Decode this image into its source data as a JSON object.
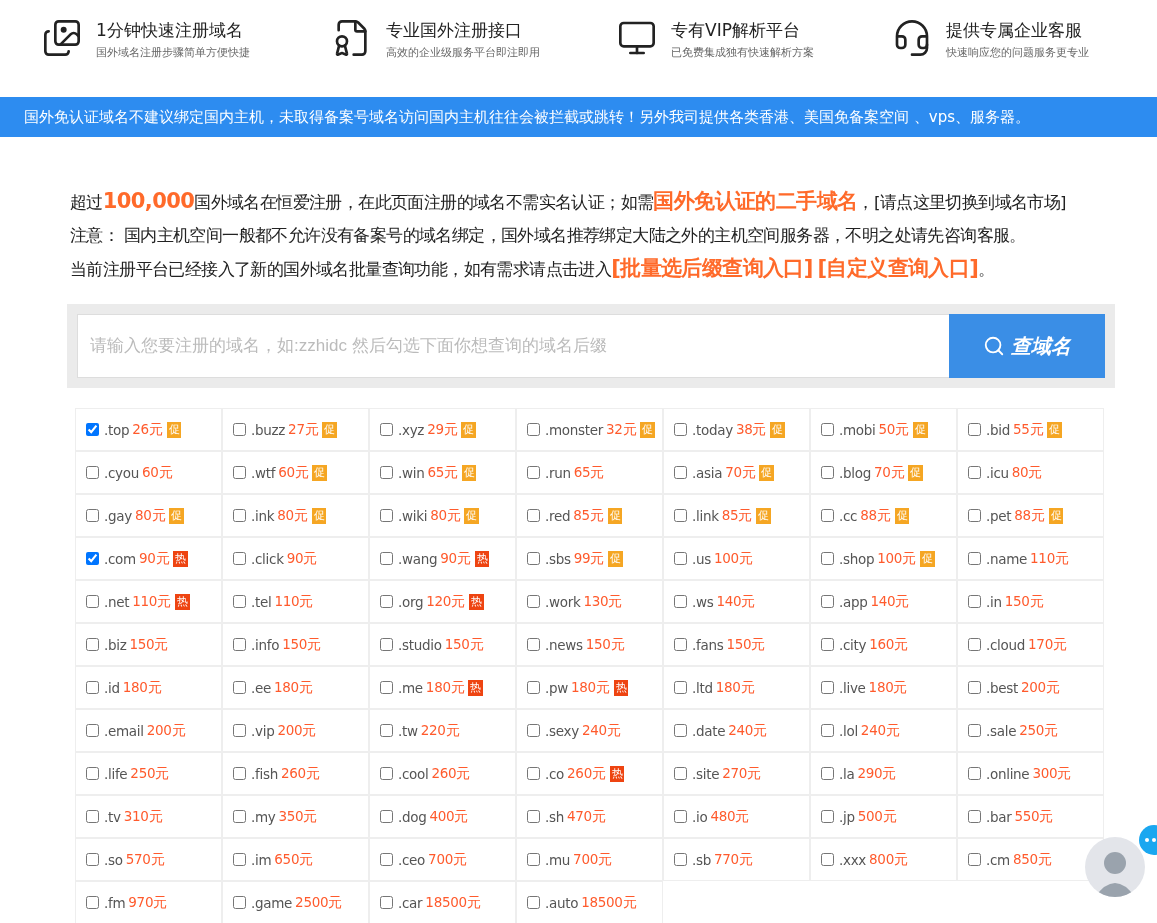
{
  "features": [
    {
      "title": "1分钟快速注册域名",
      "subtitle": "国外域名注册步骤简单方便快捷"
    },
    {
      "title": "专业国外注册接口",
      "subtitle": "高效的企业级服务平台即注即用"
    },
    {
      "title": "专有VIP解析平台",
      "subtitle": "已免费集成独有快速解析方案"
    },
    {
      "title": "提供专属企业客服",
      "subtitle": "快速响应您的问题服务更专业"
    }
  ],
  "notice": "国外免认证域名不建议绑定国内主机，未取得备案号域名访问国内主机往往会被拦截或跳转！另外我司提供各类香港、美国免备案空间 、vps、服务器。",
  "intro": [
    "超过**100,000**国外域名在恒爱注册，在此页面注册的域名不需实名认证；如需**国外免认证的二手域名**，[请点这里切换到域名市场]",
    "注意： 国内主机空间一般都不允许没有备案号的域名绑定，国外域名推荐绑定大陆之外的主机空间服务器，不明之处请先咨询客服。",
    "当前注册平台已经接入了新的国外域名批量查询功能，如有需求请点击进入**[批量选后缀查询入口]**  **[自定义查询入口]**。"
  ],
  "search": {
    "placeholder": "请输入您要注册的域名，如:zzhidc 然后勾选下面你想查询的域名后缀",
    "button": "查域名"
  },
  "domains": [
    {
      "name": ".top",
      "price": "26元",
      "checked": true,
      "tag": {
        "kind": "promo",
        "text": "促"
      }
    },
    {
      "name": ".buzz",
      "price": "27元",
      "checked": false,
      "tag": {
        "kind": "promo",
        "text": "促"
      }
    },
    {
      "name": ".xyz",
      "price": "29元",
      "checked": false,
      "tag": {
        "kind": "promo",
        "text": "促"
      }
    },
    {
      "name": ".monster",
      "price": "32元",
      "checked": false,
      "tag": {
        "kind": "promo",
        "text": "促"
      }
    },
    {
      "name": ".today",
      "price": "38元",
      "checked": false,
      "tag": {
        "kind": "promo",
        "text": "促"
      }
    },
    {
      "name": ".mobi",
      "price": "50元",
      "checked": false,
      "tag": {
        "kind": "promo",
        "text": "促"
      }
    },
    {
      "name": ".bid",
      "price": "55元",
      "checked": false,
      "tag": {
        "kind": "promo",
        "text": "促"
      }
    },
    {
      "name": ".cyou",
      "price": "60元",
      "checked": false
    },
    {
      "name": ".wtf",
      "price": "60元",
      "checked": false,
      "tag": {
        "kind": "promo",
        "text": "促"
      }
    },
    {
      "name": ".win",
      "price": "65元",
      "checked": false,
      "tag": {
        "kind": "promo",
        "text": "促"
      }
    },
    {
      "name": ".run",
      "price": "65元",
      "checked": false
    },
    {
      "name": ".asia",
      "price": "70元",
      "checked": false,
      "tag": {
        "kind": "promo",
        "text": "促"
      }
    },
    {
      "name": ".blog",
      "price": "70元",
      "checked": false,
      "tag": {
        "kind": "promo",
        "text": "促"
      }
    },
    {
      "name": ".icu",
      "price": "80元",
      "checked": false
    },
    {
      "name": ".gay",
      "price": "80元",
      "checked": false,
      "tag": {
        "kind": "promo",
        "text": "促"
      }
    },
    {
      "name": ".ink",
      "price": "80元",
      "checked": false,
      "tag": {
        "kind": "promo",
        "text": "促"
      }
    },
    {
      "name": ".wiki",
      "price": "80元",
      "checked": false,
      "tag": {
        "kind": "promo",
        "text": "促"
      }
    },
    {
      "name": ".red",
      "price": "85元",
      "checked": false,
      "tag": {
        "kind": "promo",
        "text": "促"
      }
    },
    {
      "name": ".link",
      "price": "85元",
      "checked": false,
      "tag": {
        "kind": "promo",
        "text": "促"
      }
    },
    {
      "name": ".cc",
      "price": "88元",
      "checked": false,
      "tag": {
        "kind": "promo",
        "text": "促"
      }
    },
    {
      "name": ".pet",
      "price": "88元",
      "checked": false,
      "tag": {
        "kind": "promo",
        "text": "促"
      }
    },
    {
      "name": ".com",
      "price": "90元",
      "checked": true,
      "tag": {
        "kind": "hot",
        "text": "热"
      }
    },
    {
      "name": ".click",
      "price": "90元",
      "checked": false
    },
    {
      "name": ".wang",
      "price": "90元",
      "checked": false,
      "tag": {
        "kind": "hot",
        "text": "热"
      }
    },
    {
      "name": ".sbs",
      "price": "99元",
      "checked": false,
      "tag": {
        "kind": "promo",
        "text": "促"
      }
    },
    {
      "name": ".us",
      "price": "100元",
      "checked": false
    },
    {
      "name": ".shop",
      "price": "100元",
      "checked": false,
      "tag": {
        "kind": "promo",
        "text": "促"
      }
    },
    {
      "name": ".name",
      "price": "110元",
      "checked": false
    },
    {
      "name": ".net",
      "price": "110元",
      "checked": false,
      "tag": {
        "kind": "hot",
        "text": "热"
      }
    },
    {
      "name": ".tel",
      "price": "110元",
      "checked": false
    },
    {
      "name": ".org",
      "price": "120元",
      "checked": false,
      "tag": {
        "kind": "hot",
        "text": "热"
      }
    },
    {
      "name": ".work",
      "price": "130元",
      "checked": false
    },
    {
      "name": ".ws",
      "price": "140元",
      "checked": false
    },
    {
      "name": ".app",
      "price": "140元",
      "checked": false
    },
    {
      "name": ".in",
      "price": "150元",
      "checked": false
    },
    {
      "name": ".biz",
      "price": "150元",
      "checked": false
    },
    {
      "name": ".info",
      "price": "150元",
      "checked": false
    },
    {
      "name": ".studio",
      "price": "150元",
      "checked": false
    },
    {
      "name": ".news",
      "price": "150元",
      "checked": false
    },
    {
      "name": ".fans",
      "price": "150元",
      "checked": false
    },
    {
      "name": ".city",
      "price": "160元",
      "checked": false
    },
    {
      "name": ".cloud",
      "price": "170元",
      "checked": false
    },
    {
      "name": ".id",
      "price": "180元",
      "checked": false
    },
    {
      "name": ".ee",
      "price": "180元",
      "checked": false
    },
    {
      "name": ".me",
      "price": "180元",
      "checked": false,
      "tag": {
        "kind": "hot",
        "text": "热"
      }
    },
    {
      "name": ".pw",
      "price": "180元",
      "checked": false,
      "tag": {
        "kind": "hot",
        "text": "热"
      }
    },
    {
      "name": ".ltd",
      "price": "180元",
      "checked": false
    },
    {
      "name": ".live",
      "price": "180元",
      "checked": false
    },
    {
      "name": ".best",
      "price": "200元",
      "checked": false
    },
    {
      "name": ".email",
      "price": "200元",
      "checked": false
    },
    {
      "name": ".vip",
      "price": "200元",
      "checked": false
    },
    {
      "name": ".tw",
      "price": "220元",
      "checked": false
    },
    {
      "name": ".sexy",
      "price": "240元",
      "checked": false
    },
    {
      "name": ".date",
      "price": "240元",
      "checked": false
    },
    {
      "name": ".lol",
      "price": "240元",
      "checked": false
    },
    {
      "name": ".sale",
      "price": "250元",
      "checked": false
    },
    {
      "name": ".life",
      "price": "250元",
      "checked": false
    },
    {
      "name": ".fish",
      "price": "260元",
      "checked": false
    },
    {
      "name": ".cool",
      "price": "260元",
      "checked": false
    },
    {
      "name": ".co",
      "price": "260元",
      "checked": false,
      "tag": {
        "kind": "hot",
        "text": "热"
      }
    },
    {
      "name": ".site",
      "price": "270元",
      "checked": false
    },
    {
      "name": ".la",
      "price": "290元",
      "checked": false
    },
    {
      "name": ".online",
      "price": "300元",
      "checked": false
    },
    {
      "name": ".tv",
      "price": "310元",
      "checked": false
    },
    {
      "name": ".my",
      "price": "350元",
      "checked": false
    },
    {
      "name": ".dog",
      "price": "400元",
      "checked": false
    },
    {
      "name": ".sh",
      "price": "470元",
      "checked": false
    },
    {
      "name": ".io",
      "price": "480元",
      "checked": false
    },
    {
      "name": ".jp",
      "price": "500元",
      "checked": false
    },
    {
      "name": ".bar",
      "price": "550元",
      "checked": false
    },
    {
      "name": ".so",
      "price": "570元",
      "checked": false
    },
    {
      "name": ".im",
      "price": "650元",
      "checked": false
    },
    {
      "name": ".ceo",
      "price": "700元",
      "checked": false
    },
    {
      "name": ".mu",
      "price": "700元",
      "checked": false
    },
    {
      "name": ".sb",
      "price": "770元",
      "checked": false
    },
    {
      "name": ".xxx",
      "price": "800元",
      "checked": false
    },
    {
      "name": ".cm",
      "price": "850元",
      "checked": false
    },
    {
      "name": ".fm",
      "price": "970元",
      "checked": false
    },
    {
      "name": ".game",
      "price": "2500元",
      "checked": false
    },
    {
      "name": ".car",
      "price": "18500元",
      "checked": false
    },
    {
      "name": ".auto",
      "price": "18500元",
      "checked": false
    }
  ]
}
